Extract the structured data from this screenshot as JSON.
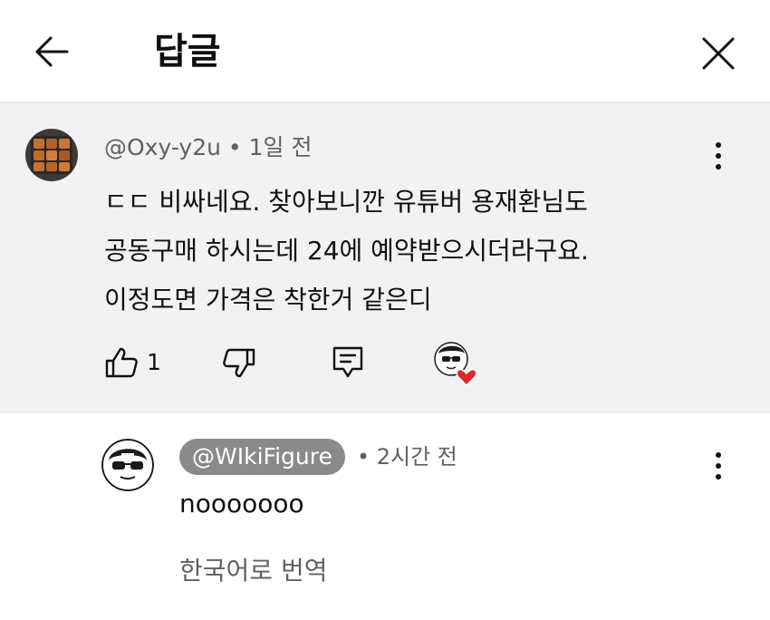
{
  "header": {
    "title": "답글",
    "back_icon": "arrow-left-icon",
    "close_icon": "close-icon"
  },
  "parent_comment": {
    "author": "@Oxy-y2u",
    "separator": "•",
    "time": "1일 전",
    "lines": [
      "ㄷㄷ 비싸네요. 찾아보니깐 유튜버 용재환님도",
      "공동구매 하시는데 24에 예약받으시더라구요.",
      "이정도면 가격은 착한거 같은디"
    ],
    "like_count": "1",
    "icons": {
      "like": "thumbs-up-icon",
      "dislike": "thumbs-down-icon",
      "reply": "reply-icon",
      "heart": "creator-heart-icon",
      "more": "more-vert-icon"
    }
  },
  "reply": {
    "author": "@WIkiFigure",
    "separator": "•",
    "time": "2시간 전",
    "text": "nooooooo",
    "translate_label": "한국어로 번역",
    "icons": {
      "more": "more-vert-icon"
    }
  },
  "colors": {
    "background": "#ffffff",
    "parent_background": "#f2f2f2",
    "secondary_text": "#606060",
    "author_badge": "#8a8a8a",
    "heart": "#e0282e"
  }
}
